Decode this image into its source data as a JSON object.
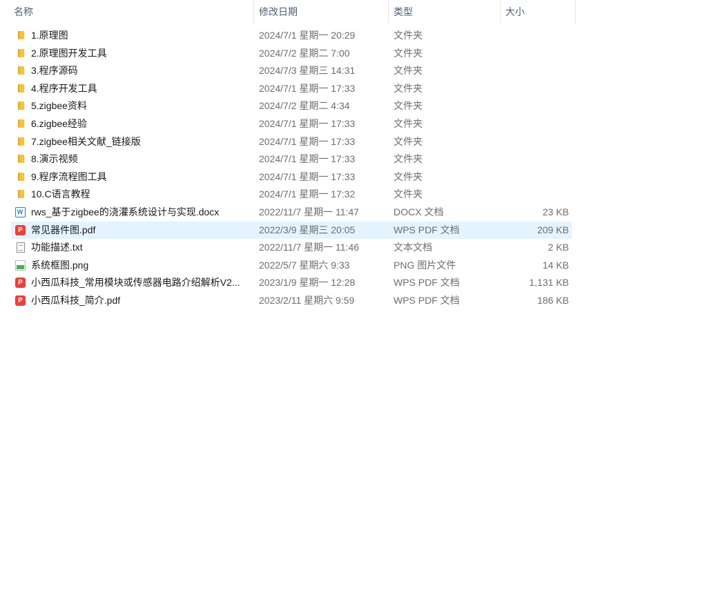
{
  "columns": {
    "name": "名称",
    "date": "修改日期",
    "type": "类型",
    "size": "大小"
  },
  "sort_indicator": "^",
  "files": [
    {
      "icon": "folder-icon",
      "name": "1.原理图",
      "date": "2024/7/1 星期一 20:29",
      "type": "文件夹",
      "size": ""
    },
    {
      "icon": "folder-icon",
      "name": "2.原理图开发工具",
      "date": "2024/7/2 星期二 7:00",
      "type": "文件夹",
      "size": ""
    },
    {
      "icon": "folder-icon",
      "name": "3.程序源码",
      "date": "2024/7/3 星期三 14:31",
      "type": "文件夹",
      "size": ""
    },
    {
      "icon": "folder-icon",
      "name": "4.程序开发工具",
      "date": "2024/7/1 星期一 17:33",
      "type": "文件夹",
      "size": ""
    },
    {
      "icon": "folder-icon",
      "name": "5.zigbee资料",
      "date": "2024/7/2 星期二 4:34",
      "type": "文件夹",
      "size": ""
    },
    {
      "icon": "folder-icon",
      "name": "6.zigbee经验",
      "date": "2024/7/1 星期一 17:33",
      "type": "文件夹",
      "size": ""
    },
    {
      "icon": "folder-icon",
      "name": "7.zigbee相关文献_链接版",
      "date": "2024/7/1 星期一 17:33",
      "type": "文件夹",
      "size": ""
    },
    {
      "icon": "folder-icon",
      "name": "8.演示视频",
      "date": "2024/7/1 星期一 17:33",
      "type": "文件夹",
      "size": ""
    },
    {
      "icon": "folder-icon",
      "name": "9.程序流程图工具",
      "date": "2024/7/1 星期一 17:33",
      "type": "文件夹",
      "size": ""
    },
    {
      "icon": "folder-icon",
      "name": "10.C语言教程",
      "date": "2024/7/1 星期一 17:32",
      "type": "文件夹",
      "size": ""
    },
    {
      "icon": "word-icon",
      "name": "rws_基于zigbee的浇灌系统设计与实现.docx",
      "date": "2022/11/7 星期一 11:47",
      "type": "DOCX 文档",
      "size": "23 KB"
    },
    {
      "icon": "pdf-icon",
      "name": "常见器件图.pdf",
      "date": "2022/3/9 星期三 20:05",
      "type": "WPS PDF 文档",
      "size": "209 KB",
      "selected": true
    },
    {
      "icon": "txt-icon",
      "name": "功能描述.txt",
      "date": "2022/11/7 星期一 11:46",
      "type": "文本文档",
      "size": "2 KB"
    },
    {
      "icon": "png-icon",
      "name": "系统框图.png",
      "date": "2022/5/7 星期六 9:33",
      "type": "PNG 图片文件",
      "size": "14 KB"
    },
    {
      "icon": "pdf-icon",
      "name": "小西瓜科技_常用模块或传感器电路介绍解析V2...",
      "date": "2023/1/9 星期一 12:28",
      "type": "WPS PDF 文档",
      "size": "1,131 KB"
    },
    {
      "icon": "pdf-icon",
      "name": "小西瓜科技_简介.pdf",
      "date": "2023/2/11 星期六 9:59",
      "type": "WPS PDF 文档",
      "size": "186 KB"
    }
  ]
}
